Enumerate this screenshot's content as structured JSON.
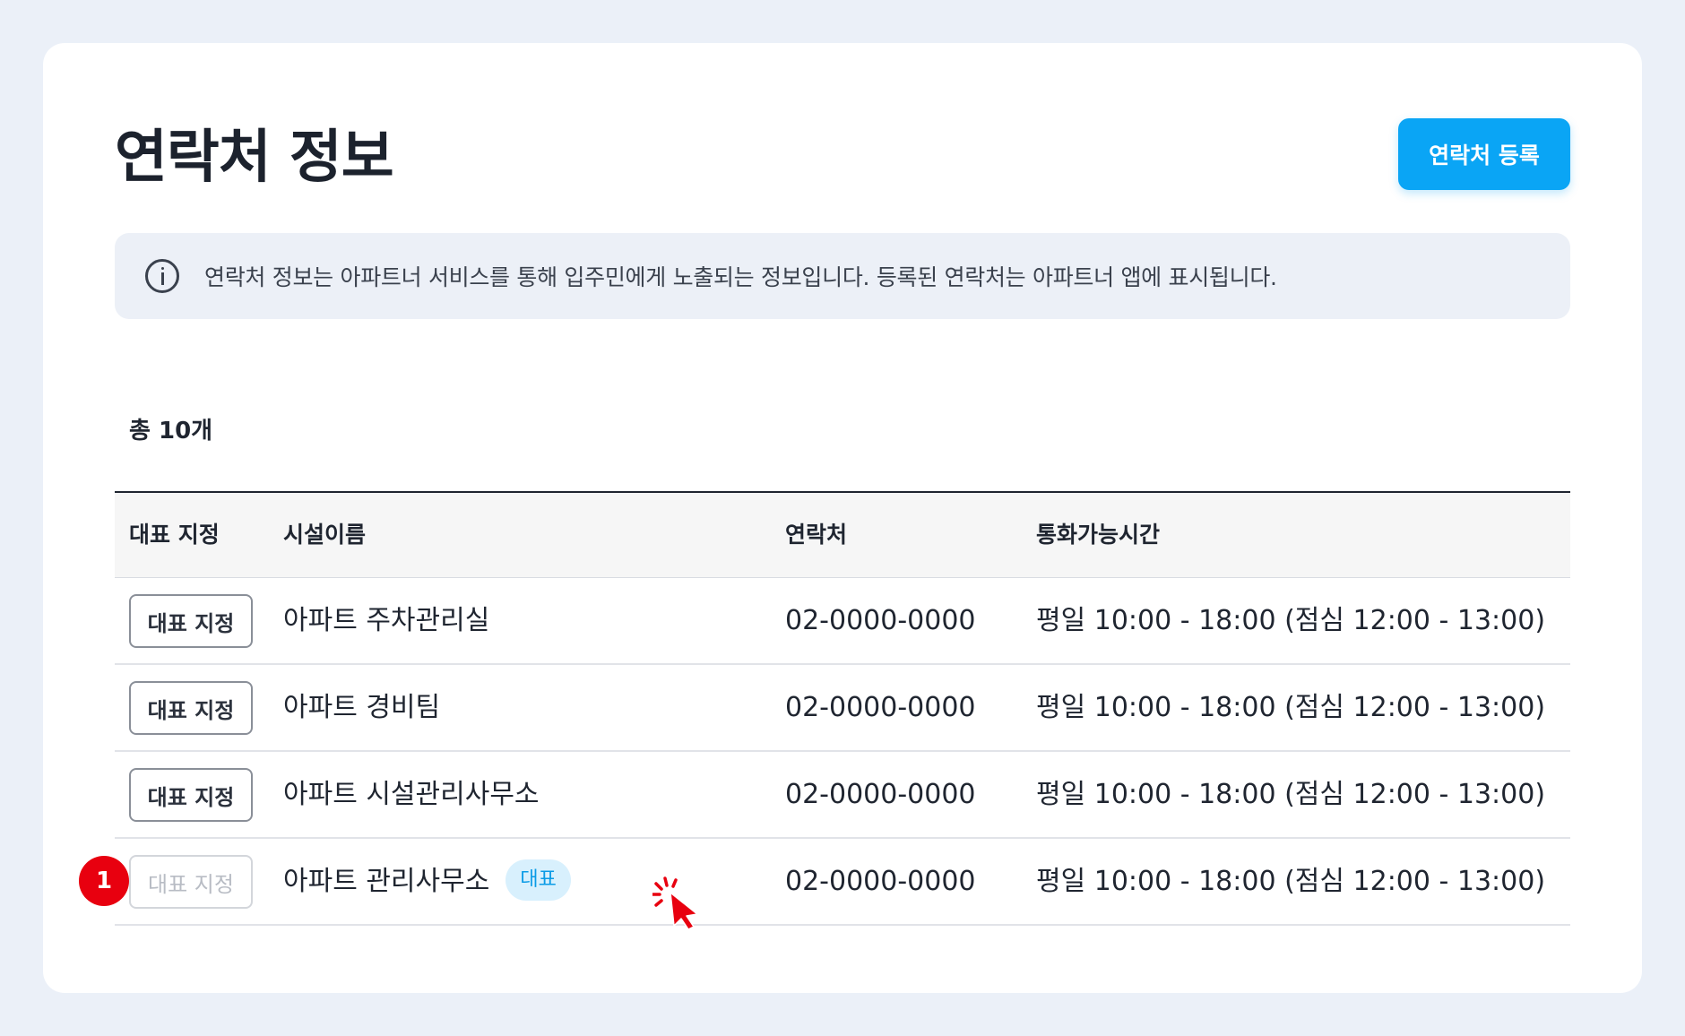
{
  "header": {
    "title": "연락처 정보",
    "register_label": "연락처 등록"
  },
  "notice": {
    "icon": "info-icon",
    "text": "연락처 정보는 아파트너 서비스를 통해 입주민에게 노출되는 정보입니다. 등록된 연락처는 아파트너 앱에 표시됩니다."
  },
  "summary": {
    "total_label": "총 10개"
  },
  "table": {
    "headers": [
      "대표 지정",
      "시설이름",
      "연락처",
      "통화가능시간"
    ],
    "rows": [
      {
        "action_label": "대표 지정",
        "facility": "아파트 주차관리실",
        "phone": "02-0000-0000",
        "hours": "평일 10:00 - 18:00 (점심 12:00 - 13:00)",
        "is_primary": false
      },
      {
        "action_label": "대표 지정",
        "facility": "아파트 경비팀",
        "phone": "02-0000-0000",
        "hours": "평일 10:00 - 18:00 (점심 12:00 - 13:00)",
        "is_primary": false
      },
      {
        "action_label": "대표 지정",
        "facility": "아파트 시설관리사무소",
        "phone": "02-0000-0000",
        "hours": "평일 10:00 - 18:00 (점심 12:00 - 13:00)",
        "is_primary": false
      },
      {
        "action_label": "대표 지정",
        "facility": "아파트 관리사무소",
        "badge": "대표",
        "phone": "02-0000-0000",
        "hours": "평일 10:00 - 18:00 (점심 12:00 - 13:00)",
        "is_primary": true
      }
    ]
  },
  "annotation": {
    "step_number": "1"
  },
  "colors": {
    "accent": "#0aa5f5",
    "badge_bg": "#d8f0fd",
    "marker": "#e8000f",
    "background": "#ebf0f8"
  }
}
